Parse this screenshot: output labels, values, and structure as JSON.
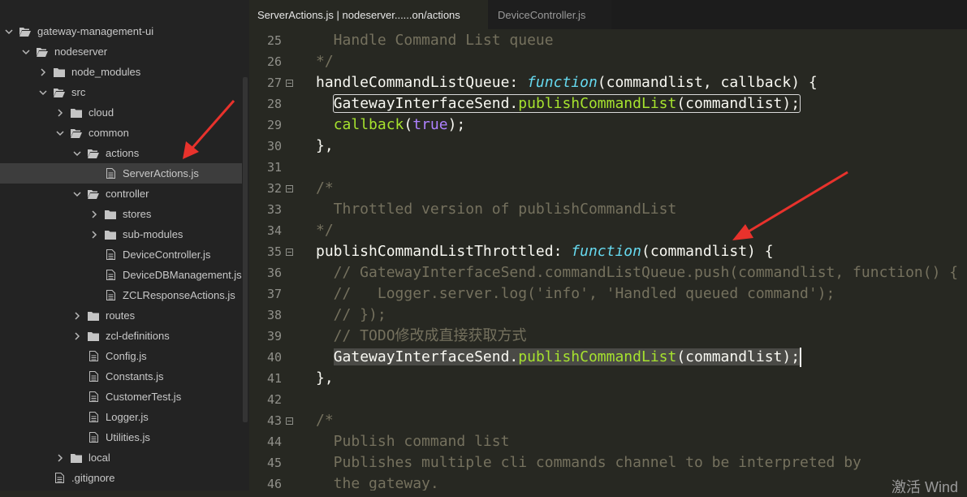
{
  "sidebar": {
    "items": [
      {
        "label": "gateway-management-ui",
        "type": "folder",
        "state": "open",
        "depth": 0
      },
      {
        "label": "nodeserver",
        "type": "folder",
        "state": "open",
        "depth": 1
      },
      {
        "label": "node_modules",
        "type": "folder",
        "state": "closed",
        "depth": 2
      },
      {
        "label": "src",
        "type": "folder",
        "state": "open",
        "depth": 2
      },
      {
        "label": "cloud",
        "type": "folder",
        "state": "closed",
        "depth": 3
      },
      {
        "label": "common",
        "type": "folder",
        "state": "open",
        "depth": 3
      },
      {
        "label": "actions",
        "type": "folder",
        "state": "open",
        "depth": 4
      },
      {
        "label": "ServerActions.js",
        "type": "file",
        "depth": 5,
        "selected": true
      },
      {
        "label": "controller",
        "type": "folder",
        "state": "open",
        "depth": 4
      },
      {
        "label": "stores",
        "type": "folder",
        "state": "closed",
        "depth": 5
      },
      {
        "label": "sub-modules",
        "type": "folder",
        "state": "closed",
        "depth": 5
      },
      {
        "label": "DeviceController.js",
        "type": "file",
        "depth": 5
      },
      {
        "label": "DeviceDBManagement.js",
        "type": "file",
        "depth": 5
      },
      {
        "label": "ZCLResponseActions.js",
        "type": "file",
        "depth": 5
      },
      {
        "label": "routes",
        "type": "folder",
        "state": "closed",
        "depth": 4
      },
      {
        "label": "zcl-definitions",
        "type": "folder",
        "state": "closed",
        "depth": 4
      },
      {
        "label": "Config.js",
        "type": "file",
        "depth": 4
      },
      {
        "label": "Constants.js",
        "type": "file",
        "depth": 4
      },
      {
        "label": "CustomerTest.js",
        "type": "file",
        "depth": 4
      },
      {
        "label": "Logger.js",
        "type": "file",
        "depth": 4
      },
      {
        "label": "Utilities.js",
        "type": "file",
        "depth": 4
      },
      {
        "label": "local",
        "type": "folder",
        "state": "closed",
        "depth": 3
      },
      {
        "label": ".gitignore",
        "type": "file",
        "depth": 2
      }
    ]
  },
  "tabs": [
    {
      "label": "ServerActions.js | nodeserver......on/actions",
      "active": true
    },
    {
      "label": "DeviceController.js",
      "active": false
    }
  ],
  "editor": {
    "lines": [
      {
        "n": "25",
        "fold": false,
        "tokens": [
          [
            "c",
            "  Handle Command List queue"
          ]
        ]
      },
      {
        "n": "26",
        "fold": false,
        "tokens": [
          [
            "c",
            "*/"
          ]
        ]
      },
      {
        "n": "27",
        "fold": true,
        "tokens": [
          [
            "pl",
            "handleCommandListQueue: "
          ],
          [
            "kw",
            "function"
          ],
          [
            "pl",
            "(commandlist, callback) {"
          ]
        ]
      },
      {
        "n": "28",
        "fold": false,
        "tokens": [
          [
            "pl",
            "  "
          ],
          [
            "pl",
            "GatewayInterfaceSend.",
            "box"
          ],
          [
            "fn",
            "publishCommandList",
            "box"
          ],
          [
            "pl",
            "(commandlist);",
            "box"
          ]
        ]
      },
      {
        "n": "29",
        "fold": false,
        "tokens": [
          [
            "pl",
            "  "
          ],
          [
            "fn",
            "callback"
          ],
          [
            "pl",
            "("
          ],
          [
            "bool",
            "true"
          ],
          [
            "pl",
            ");"
          ]
        ]
      },
      {
        "n": "30",
        "fold": false,
        "tokens": [
          [
            "pl",
            "},"
          ]
        ]
      },
      {
        "n": "31",
        "fold": false,
        "tokens": []
      },
      {
        "n": "32",
        "fold": true,
        "tokens": [
          [
            "c",
            "/*"
          ]
        ]
      },
      {
        "n": "33",
        "fold": false,
        "tokens": [
          [
            "c",
            "  Throttled version of publishCommandList"
          ]
        ]
      },
      {
        "n": "34",
        "fold": false,
        "tokens": [
          [
            "c",
            "*/"
          ]
        ]
      },
      {
        "n": "35",
        "fold": true,
        "tokens": [
          [
            "pl",
            "publishCommandListThrottled: "
          ],
          [
            "kw",
            "function"
          ],
          [
            "pl",
            "(commandlist) {"
          ]
        ]
      },
      {
        "n": "36",
        "fold": false,
        "tokens": [
          [
            "c",
            "  // GatewayInterfaceSend.commandListQueue.push(commandlist, function() {"
          ]
        ]
      },
      {
        "n": "37",
        "fold": false,
        "tokens": [
          [
            "c",
            "  //   Logger.server.log('info', 'Handled queued command');"
          ]
        ]
      },
      {
        "n": "38",
        "fold": false,
        "tokens": [
          [
            "c",
            "  // });"
          ]
        ]
      },
      {
        "n": "39",
        "fold": false,
        "tokens": [
          [
            "c",
            "  // TODO修改成直接获取方式"
          ]
        ]
      },
      {
        "n": "40",
        "fold": false,
        "tokens": [
          [
            "pl",
            "  "
          ],
          [
            "pl",
            "GatewayInterfaceSend.",
            "hl"
          ],
          [
            "fn",
            "publishCommandList",
            "hl"
          ],
          [
            "pl",
            "(commandlist);",
            "hl"
          ]
        ]
      },
      {
        "n": "41",
        "fold": false,
        "tokens": [
          [
            "pl",
            "},"
          ]
        ]
      },
      {
        "n": "42",
        "fold": false,
        "tokens": []
      },
      {
        "n": "43",
        "fold": true,
        "tokens": [
          [
            "c",
            "/*"
          ]
        ]
      },
      {
        "n": "44",
        "fold": false,
        "tokens": [
          [
            "c",
            "  Publish command list"
          ]
        ]
      },
      {
        "n": "45",
        "fold": false,
        "tokens": [
          [
            "c",
            "  Publishes multiple cli commands channel to be interpreted by"
          ]
        ]
      },
      {
        "n": "46",
        "fold": false,
        "tokens": [
          [
            "c",
            "  the gateway."
          ]
        ]
      }
    ]
  },
  "colors": {
    "sidebar_bg": "#232323",
    "editor_bg": "#272822",
    "comment": "#75715e",
    "keyword": "#66d9ef",
    "function": "#a6e22e",
    "boolean": "#ae81ff",
    "annotation_arrow": "#e8322c"
  },
  "watermark": "激活 Wind"
}
